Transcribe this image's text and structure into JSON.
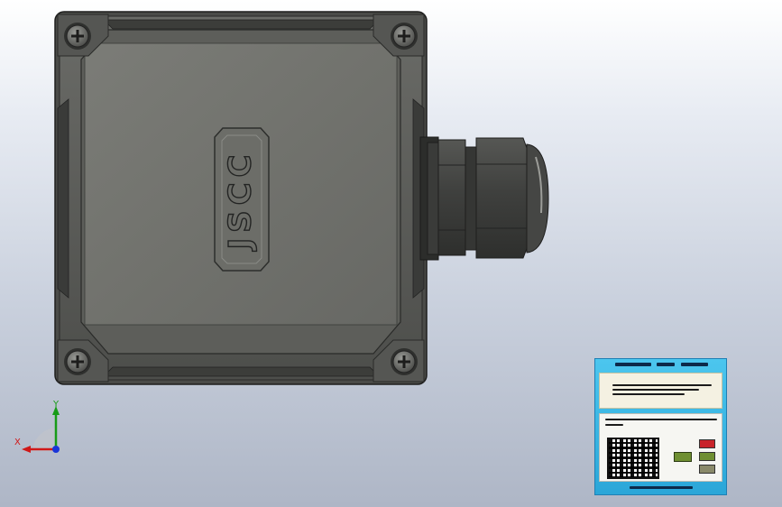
{
  "viewport": {
    "background_top": "#ffffff",
    "background_bottom": "#aeb6c6"
  },
  "model": {
    "enclosure_logo": "JSCC",
    "body_color": "#5f605d",
    "lid_color": "#73746f",
    "gland_color": "#3f403e",
    "icons": [
      "screw-icon",
      "screw-icon",
      "screw-icon",
      "screw-icon"
    ]
  },
  "triad": {
    "x_label": "X",
    "y_label": "Y",
    "x_color": "#d01818",
    "y_color": "#179b17",
    "z_color": "#1a35d8"
  },
  "info_card": {
    "accent": "#2aa6d8",
    "badge_colors": [
      "#c8242a",
      "#6f8f32",
      "#8a8a6a"
    ]
  }
}
